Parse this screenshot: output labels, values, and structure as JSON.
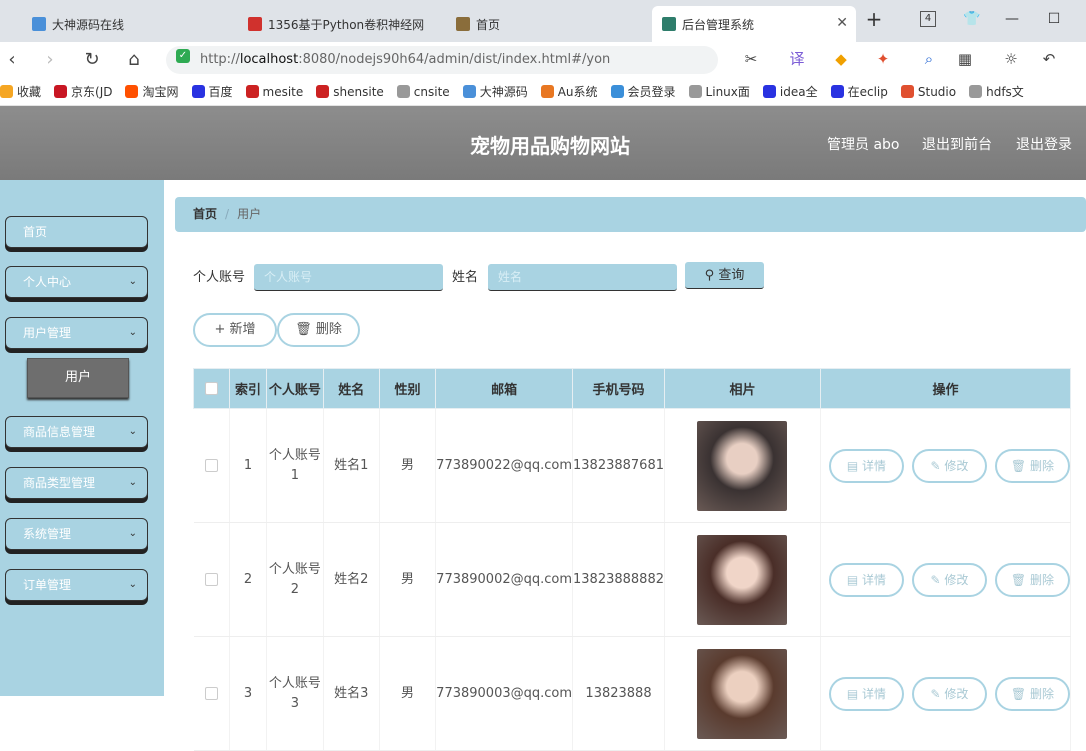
{
  "browser": {
    "tabs": [
      {
        "title": "大神源码在线",
        "color": "#4a90d9"
      },
      {
        "title": "1356基于Python卷积神经网",
        "color": "#d0312d"
      },
      {
        "title": "首页",
        "color": "#8a6d3b"
      },
      {
        "title": "后台管理系统",
        "color": "#2e7d6b"
      }
    ],
    "tab_counter": "4",
    "url_prefix": "http://",
    "url_host": "localhost",
    "url_rest": ":8080/nodejs90h64/admin/dist/index.html#/yon",
    "bookmarks": [
      {
        "label": "收藏",
        "color": "#f5a623"
      },
      {
        "label": "京东(JD",
        "color": "#c81623"
      },
      {
        "label": "淘宝网",
        "color": "#ff5000"
      },
      {
        "label": "百度",
        "color": "#2932e1"
      },
      {
        "label": "mesite",
        "color": "#cc2222"
      },
      {
        "label": "shensite",
        "color": "#cc2222"
      },
      {
        "label": "cnsite",
        "color": "#999999"
      },
      {
        "label": "大神源码",
        "color": "#4a90d9"
      },
      {
        "label": "Au系统",
        "color": "#e87722"
      },
      {
        "label": "会员登录",
        "color": "#3b8fd9"
      },
      {
        "label": "Linux面",
        "color": "#999999"
      },
      {
        "label": "idea全",
        "color": "#2932e1"
      },
      {
        "label": "在eclip",
        "color": "#2932e1"
      },
      {
        "label": "Studio",
        "color": "#e05030"
      },
      {
        "label": "hdfs文",
        "color": "#999999"
      }
    ]
  },
  "header": {
    "title": "宠物用品购物网站",
    "user": "管理员 abo",
    "to_front": "退出到前台",
    "logout": "退出登录"
  },
  "sidebar": {
    "items": [
      {
        "label": "首页",
        "chevron": false
      },
      {
        "label": "个人中心",
        "chevron": true
      },
      {
        "label": "用户管理",
        "chevron": true
      },
      {
        "label": "商品信息管理",
        "chevron": true
      },
      {
        "label": "商品类型管理",
        "chevron": true
      },
      {
        "label": "系统管理",
        "chevron": true
      },
      {
        "label": "订单管理",
        "chevron": true
      }
    ],
    "sub_item": "用户"
  },
  "breadcrumb": {
    "home": "首页",
    "separator": "/",
    "current": "用户"
  },
  "search": {
    "account_label": "个人账号",
    "account_placeholder": "个人账号",
    "name_label": "姓名",
    "name_placeholder": "姓名",
    "query_button": "查询"
  },
  "actions": {
    "add": "新增",
    "delete": "删除"
  },
  "table": {
    "headers": [
      "",
      "索引",
      "个人账号",
      "姓名",
      "性别",
      "邮箱",
      "手机号码",
      "相片",
      "操作"
    ],
    "rows": [
      {
        "index": "1",
        "account": "个人账号1",
        "name": "姓名1",
        "gender": "男",
        "email": "773890022@qq.com",
        "phone": "13823887681",
        "photo_colors": [
          "#3a3232",
          "#e8cfc3"
        ]
      },
      {
        "index": "2",
        "account": "个人账号2",
        "name": "姓名2",
        "gender": "男",
        "email": "773890002@qq.com",
        "phone": "13823888882",
        "photo_colors": [
          "#4a2e28",
          "#f0d5c8"
        ]
      },
      {
        "index": "3",
        "account": "个人账号3",
        "name": "姓名3",
        "gender": "男",
        "email": "773890003@qq.com",
        "phone": "13823888",
        "photo_colors": [
          "#5a3b2e",
          "#ecd0c0"
        ]
      }
    ],
    "op_detail": "详情",
    "op_edit": "修改",
    "op_delete": "删除"
  },
  "colors": {
    "accent": "#a9d3e2",
    "header": "#808080"
  }
}
